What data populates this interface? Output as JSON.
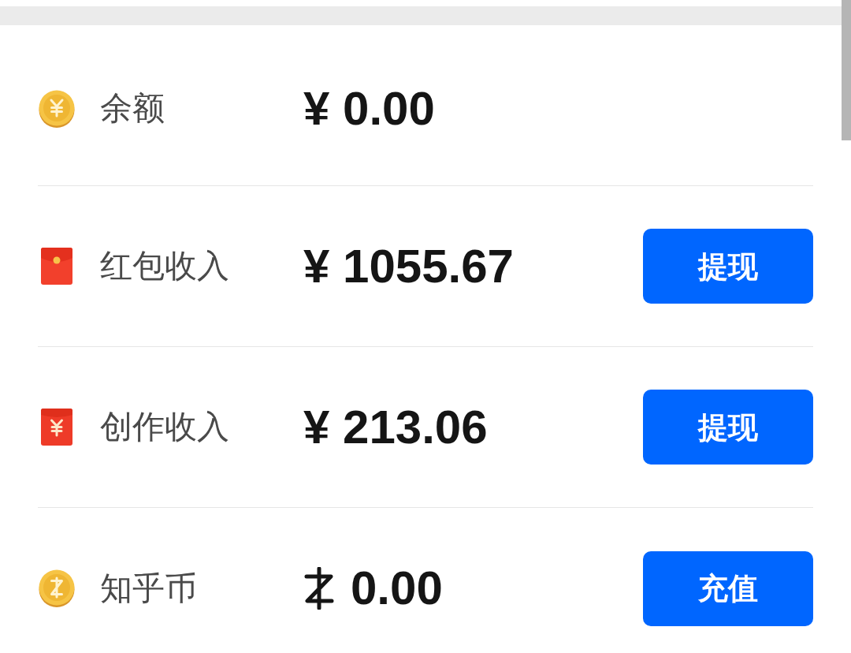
{
  "rows": [
    {
      "kind": "yuancoin",
      "label": "余额",
      "amount": "¥ 0.00"
    },
    {
      "kind": "envelope",
      "label": "红包收入",
      "amount": "¥ 1055.67",
      "button": "提现"
    },
    {
      "kind": "yuanenvelope",
      "label": "创作收入",
      "amount": "¥ 213.06",
      "button": "提现"
    },
    {
      "kind": "zhihucoin",
      "label": "知乎币",
      "amount": "0.00",
      "button": "充值"
    }
  ]
}
